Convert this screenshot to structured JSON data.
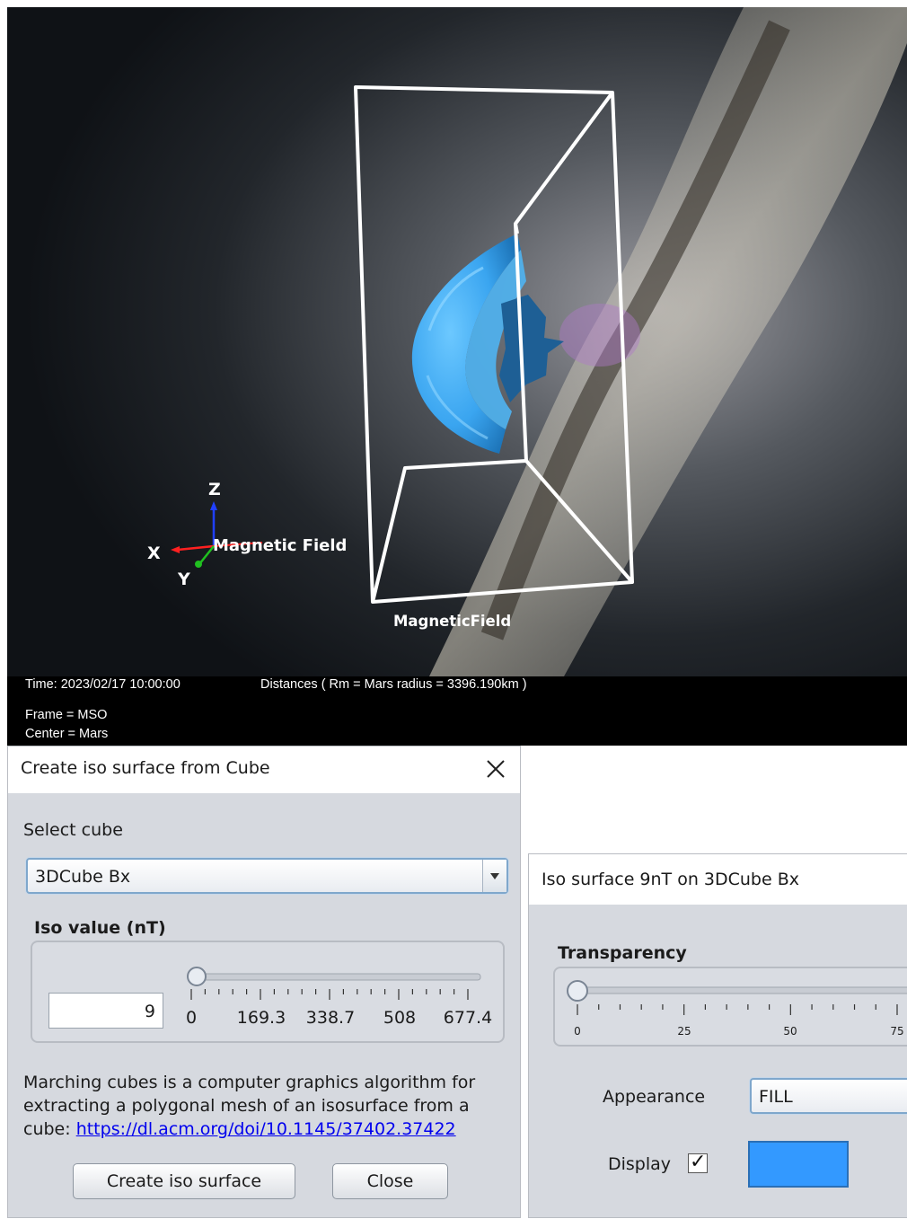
{
  "viewport": {
    "time_label": "Time: 2023/02/17 10:00:00",
    "distances_label": "Distances ( Rm = Mars radius = 3396.190km )",
    "frame_label": "Frame = MSO",
    "center_label": "Center = Mars",
    "axis_x_label": "X",
    "axis_y_label": "Y",
    "axis_z_label": "Z",
    "axes_caption": "Magnetic Field",
    "box_caption": "MagneticField",
    "colors": {
      "iso_surface": "#3aa5f0",
      "box_outline": "#ffffff",
      "axis_x": "#ff2020",
      "axis_y": "#20c020",
      "axis_z": "#2040ff"
    }
  },
  "iso_dialog": {
    "title": "Create iso surface from Cube",
    "close_icon": "close-icon",
    "select_cube_label": "Select cube",
    "cube_selected": "3DCube  Bx",
    "iso_value_label": "Iso value (nT)",
    "iso_value": "9",
    "slider": {
      "value_fraction": 0.013,
      "tick_labels": [
        "0",
        "169.3",
        "338.7",
        "508",
        "677.4"
      ]
    },
    "description": "Marching cubes is a computer graphics algorithm for extracting a polygonal mesh of an isosurface from a cube: ",
    "link_text": "https://dl.acm.org/doi/10.1145/37402.37422",
    "create_button": "Create iso surface",
    "close_button": "Close"
  },
  "props_dialog": {
    "title": "Iso surface 9nT on 3DCube  Bx",
    "transparency_label": "Transparency",
    "transparency_slider": {
      "value": 0,
      "tick_labels": [
        "0",
        "25",
        "50",
        "75"
      ]
    },
    "appearance_label": "Appearance",
    "appearance_value": "FILL",
    "display_label": "Display",
    "display_checked": true,
    "check_glyph": "✓",
    "surface_color": "#3399ff"
  }
}
